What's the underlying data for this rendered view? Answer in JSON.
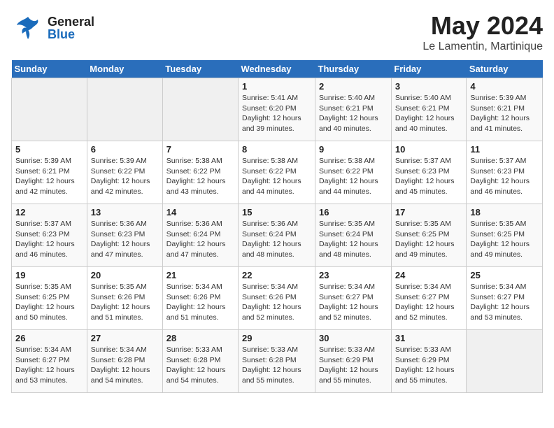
{
  "header": {
    "logo_general": "General",
    "logo_blue": "Blue",
    "month": "May 2024",
    "location": "Le Lamentin, Martinique"
  },
  "weekdays": [
    "Sunday",
    "Monday",
    "Tuesday",
    "Wednesday",
    "Thursday",
    "Friday",
    "Saturday"
  ],
  "weeks": [
    [
      {
        "day": "",
        "info": ""
      },
      {
        "day": "",
        "info": ""
      },
      {
        "day": "",
        "info": ""
      },
      {
        "day": "1",
        "info": "Sunrise: 5:41 AM\nSunset: 6:20 PM\nDaylight: 12 hours and 39 minutes."
      },
      {
        "day": "2",
        "info": "Sunrise: 5:40 AM\nSunset: 6:21 PM\nDaylight: 12 hours and 40 minutes."
      },
      {
        "day": "3",
        "info": "Sunrise: 5:40 AM\nSunset: 6:21 PM\nDaylight: 12 hours and 40 minutes."
      },
      {
        "day": "4",
        "info": "Sunrise: 5:39 AM\nSunset: 6:21 PM\nDaylight: 12 hours and 41 minutes."
      }
    ],
    [
      {
        "day": "5",
        "info": "Sunrise: 5:39 AM\nSunset: 6:21 PM\nDaylight: 12 hours and 42 minutes."
      },
      {
        "day": "6",
        "info": "Sunrise: 5:39 AM\nSunset: 6:22 PM\nDaylight: 12 hours and 42 minutes."
      },
      {
        "day": "7",
        "info": "Sunrise: 5:38 AM\nSunset: 6:22 PM\nDaylight: 12 hours and 43 minutes."
      },
      {
        "day": "8",
        "info": "Sunrise: 5:38 AM\nSunset: 6:22 PM\nDaylight: 12 hours and 44 minutes."
      },
      {
        "day": "9",
        "info": "Sunrise: 5:38 AM\nSunset: 6:22 PM\nDaylight: 12 hours and 44 minutes."
      },
      {
        "day": "10",
        "info": "Sunrise: 5:37 AM\nSunset: 6:23 PM\nDaylight: 12 hours and 45 minutes."
      },
      {
        "day": "11",
        "info": "Sunrise: 5:37 AM\nSunset: 6:23 PM\nDaylight: 12 hours and 46 minutes."
      }
    ],
    [
      {
        "day": "12",
        "info": "Sunrise: 5:37 AM\nSunset: 6:23 PM\nDaylight: 12 hours and 46 minutes."
      },
      {
        "day": "13",
        "info": "Sunrise: 5:36 AM\nSunset: 6:23 PM\nDaylight: 12 hours and 47 minutes."
      },
      {
        "day": "14",
        "info": "Sunrise: 5:36 AM\nSunset: 6:24 PM\nDaylight: 12 hours and 47 minutes."
      },
      {
        "day": "15",
        "info": "Sunrise: 5:36 AM\nSunset: 6:24 PM\nDaylight: 12 hours and 48 minutes."
      },
      {
        "day": "16",
        "info": "Sunrise: 5:35 AM\nSunset: 6:24 PM\nDaylight: 12 hours and 48 minutes."
      },
      {
        "day": "17",
        "info": "Sunrise: 5:35 AM\nSunset: 6:25 PM\nDaylight: 12 hours and 49 minutes."
      },
      {
        "day": "18",
        "info": "Sunrise: 5:35 AM\nSunset: 6:25 PM\nDaylight: 12 hours and 49 minutes."
      }
    ],
    [
      {
        "day": "19",
        "info": "Sunrise: 5:35 AM\nSunset: 6:25 PM\nDaylight: 12 hours and 50 minutes."
      },
      {
        "day": "20",
        "info": "Sunrise: 5:35 AM\nSunset: 6:26 PM\nDaylight: 12 hours and 51 minutes."
      },
      {
        "day": "21",
        "info": "Sunrise: 5:34 AM\nSunset: 6:26 PM\nDaylight: 12 hours and 51 minutes."
      },
      {
        "day": "22",
        "info": "Sunrise: 5:34 AM\nSunset: 6:26 PM\nDaylight: 12 hours and 52 minutes."
      },
      {
        "day": "23",
        "info": "Sunrise: 5:34 AM\nSunset: 6:27 PM\nDaylight: 12 hours and 52 minutes."
      },
      {
        "day": "24",
        "info": "Sunrise: 5:34 AM\nSunset: 6:27 PM\nDaylight: 12 hours and 52 minutes."
      },
      {
        "day": "25",
        "info": "Sunrise: 5:34 AM\nSunset: 6:27 PM\nDaylight: 12 hours and 53 minutes."
      }
    ],
    [
      {
        "day": "26",
        "info": "Sunrise: 5:34 AM\nSunset: 6:27 PM\nDaylight: 12 hours and 53 minutes."
      },
      {
        "day": "27",
        "info": "Sunrise: 5:34 AM\nSunset: 6:28 PM\nDaylight: 12 hours and 54 minutes."
      },
      {
        "day": "28",
        "info": "Sunrise: 5:33 AM\nSunset: 6:28 PM\nDaylight: 12 hours and 54 minutes."
      },
      {
        "day": "29",
        "info": "Sunrise: 5:33 AM\nSunset: 6:28 PM\nDaylight: 12 hours and 55 minutes."
      },
      {
        "day": "30",
        "info": "Sunrise: 5:33 AM\nSunset: 6:29 PM\nDaylight: 12 hours and 55 minutes."
      },
      {
        "day": "31",
        "info": "Sunrise: 5:33 AM\nSunset: 6:29 PM\nDaylight: 12 hours and 55 minutes."
      },
      {
        "day": "",
        "info": ""
      }
    ]
  ]
}
